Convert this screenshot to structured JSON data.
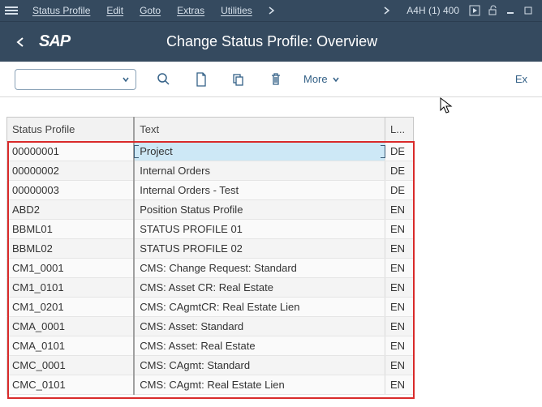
{
  "menubar": {
    "items": [
      "Status Profile",
      "Edit",
      "Goto",
      "Extras",
      "Utilities"
    ],
    "system_id": "A4H (1) 400"
  },
  "titlebar": {
    "logo_text": "SAP",
    "page_title": "Change Status Profile: Overview"
  },
  "toolbar": {
    "more_label": "More",
    "right_action": "Ex"
  },
  "table": {
    "headers": {
      "profile": "Status Profile",
      "text": "Text",
      "lang": "L..."
    },
    "rows": [
      {
        "profile": "00000001",
        "text": "Project",
        "lang": "DE",
        "selected": true
      },
      {
        "profile": "00000002",
        "text": "Internal Orders",
        "lang": "DE"
      },
      {
        "profile": "00000003",
        "text": "Internal Orders - Test",
        "lang": "DE"
      },
      {
        "profile": "ABD2",
        "text": "Position Status Profile",
        "lang": "EN"
      },
      {
        "profile": "BBML01",
        "text": "STATUS PROFILE 01",
        "lang": "EN"
      },
      {
        "profile": "BBML02",
        "text": "STATUS PROFILE 02",
        "lang": "EN"
      },
      {
        "profile": "CM1_0001",
        "text": "CMS: Change Request: Standard",
        "lang": "EN"
      },
      {
        "profile": "CM1_0101",
        "text": "CMS: Asset CR: Real Estate",
        "lang": "EN"
      },
      {
        "profile": "CM1_0201",
        "text": "CMS: CAgmtCR: Real Estate Lien",
        "lang": "EN"
      },
      {
        "profile": "CMA_0001",
        "text": "CMS: Asset: Standard",
        "lang": "EN"
      },
      {
        "profile": "CMA_0101",
        "text": "CMS: Asset: Real Estate",
        "lang": "EN"
      },
      {
        "profile": "CMC_0001",
        "text": "CMS: CAgmt: Standard",
        "lang": "EN"
      },
      {
        "profile": "CMC_0101",
        "text": "CMS: CAgmt: Real Estate Lien",
        "lang": "EN"
      }
    ]
  }
}
